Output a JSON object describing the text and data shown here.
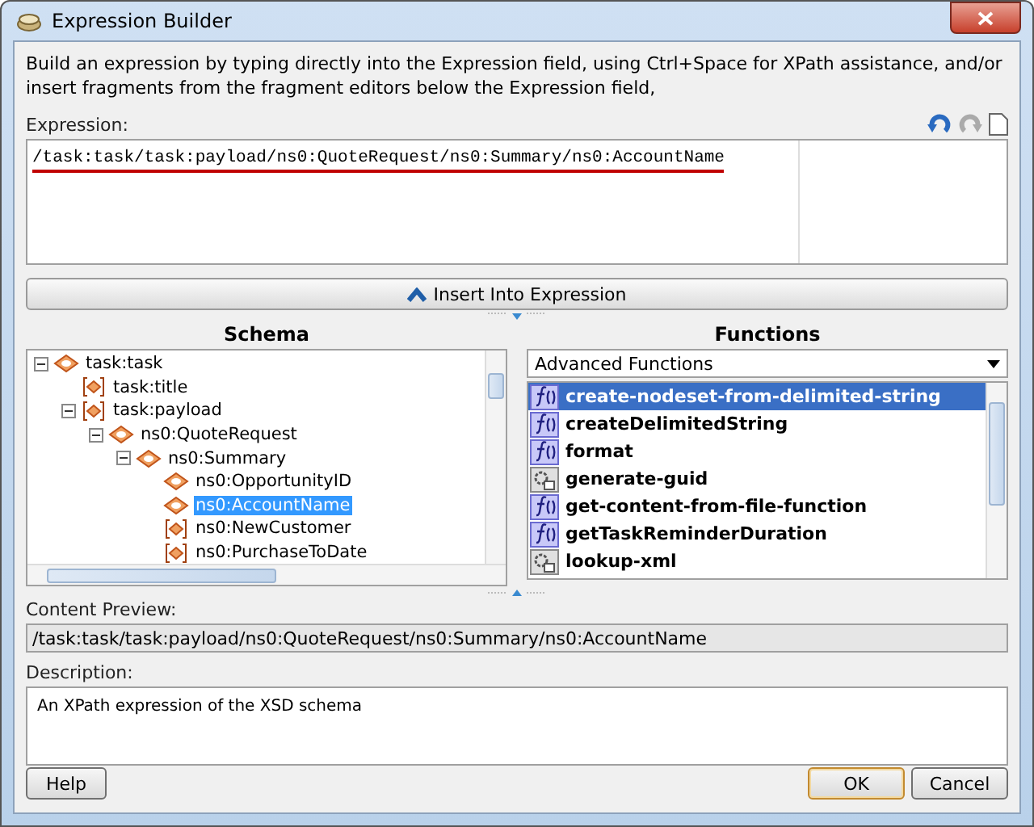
{
  "window": {
    "title": "Expression Builder"
  },
  "instructions": "Build an expression by typing directly into the Expression field, using Ctrl+Space for XPath assistance, and/or insert fragments from the fragment editors below the Expression field,",
  "expression": {
    "label": "Expression:",
    "value": "/task:task/task:payload/ns0:QuoteRequest/ns0:Summary/ns0:AccountName"
  },
  "insert_button": "Insert Into Expression",
  "schema": {
    "heading": "Schema",
    "tree": [
      {
        "label": "task:task",
        "kind": "element",
        "expanded": true,
        "selected": false,
        "children": [
          {
            "label": "task:title",
            "kind": "bracket",
            "selected": false
          },
          {
            "label": "task:payload",
            "kind": "bracket",
            "expanded": true,
            "selected": false,
            "children": [
              {
                "label": "ns0:QuoteRequest",
                "kind": "element",
                "expanded": true,
                "selected": false,
                "children": [
                  {
                    "label": "ns0:Summary",
                    "kind": "element",
                    "expanded": true,
                    "selected": false,
                    "children": [
                      {
                        "label": "ns0:OpportunityID",
                        "kind": "element",
                        "selected": false
                      },
                      {
                        "label": "ns0:AccountName",
                        "kind": "element",
                        "selected": true
                      },
                      {
                        "label": "ns0:NewCustomer",
                        "kind": "bracket",
                        "selected": false
                      },
                      {
                        "label": "ns0:PurchaseToDate",
                        "kind": "bracket",
                        "selected": false
                      }
                    ]
                  }
                ]
              }
            ]
          }
        ]
      }
    ]
  },
  "functions": {
    "heading": "Functions",
    "category": "Advanced Functions",
    "items": [
      {
        "label": "create-nodeset-from-delimited-string",
        "kind": "function",
        "selected": true
      },
      {
        "label": "createDelimitedString",
        "kind": "function",
        "selected": false
      },
      {
        "label": "format",
        "kind": "function",
        "selected": false
      },
      {
        "label": "generate-guid",
        "kind": "extension",
        "selected": false
      },
      {
        "label": "get-content-from-file-function",
        "kind": "function",
        "selected": false
      },
      {
        "label": "getTaskReminderDuration",
        "kind": "function",
        "selected": false
      },
      {
        "label": "lookup-xml",
        "kind": "extension",
        "selected": false
      }
    ]
  },
  "content_preview": {
    "label": "Content Preview:",
    "value": "/task:task/task:payload/ns0:QuoteRequest/ns0:Summary/ns0:AccountName"
  },
  "description": {
    "label": "Description:",
    "value": "An XPath expression of the XSD schema"
  },
  "buttons": [
    {
      "label": "Help",
      "kind": "help"
    },
    {
      "label": "OK",
      "kind": "default"
    },
    {
      "label": "Cancel",
      "kind": "normal"
    }
  ]
}
